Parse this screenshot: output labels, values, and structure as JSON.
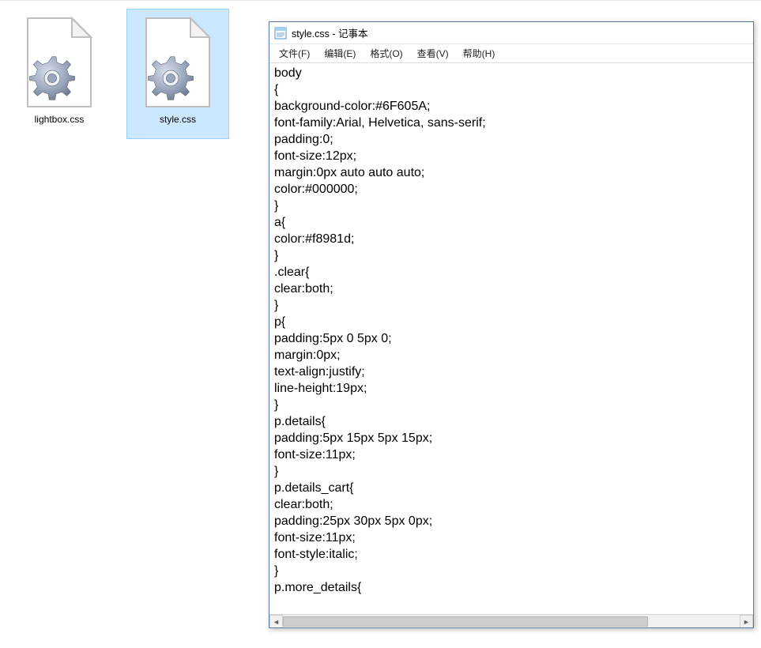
{
  "explorer": {
    "files": [
      {
        "name": "lightbox.css",
        "selected": false
      },
      {
        "name": "style.css",
        "selected": true
      }
    ]
  },
  "notepad": {
    "title": "style.css - 记事本",
    "menu": {
      "file": "文件(F)",
      "edit": "编辑(E)",
      "format": "格式(O)",
      "view": "查看(V)",
      "help": "帮助(H)"
    },
    "content": "body\n{\nbackground-color:#6F605A;\nfont-family:Arial, Helvetica, sans-serif;\npadding:0;\nfont-size:12px;\nmargin:0px auto auto auto;\ncolor:#000000;\n}\na{\ncolor:#f8981d;\n}\n.clear{\nclear:both;\n}\np{\npadding:5px 0 5px 0;\nmargin:0px;\ntext-align:justify;\nline-height:19px;\n}\np.details{\npadding:5px 15px 5px 15px;\nfont-size:11px;\n}\np.details_cart{\nclear:both;\npadding:25px 30px 5px 0px;\nfont-size:11px;\nfont-style:italic;\n}\np.more_details{"
  }
}
